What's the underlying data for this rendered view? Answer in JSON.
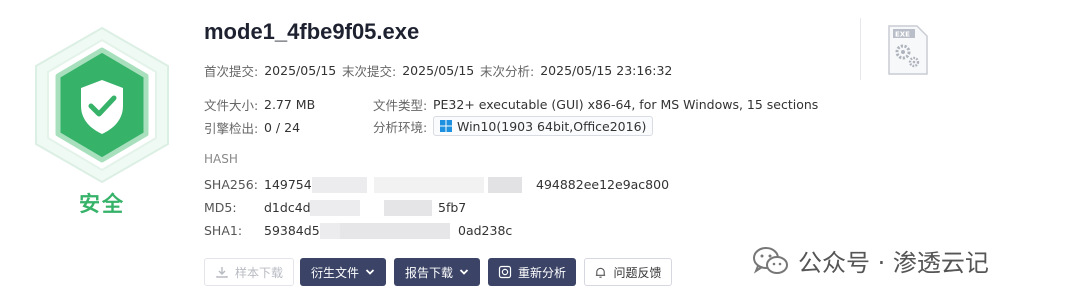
{
  "file": {
    "name": "mode1_4fbe9f05.exe"
  },
  "verdict": {
    "label": "安全",
    "color": "#36b269"
  },
  "dates": {
    "first_submit_label": "首次提交:",
    "first_submit": "2025/05/15",
    "last_submit_label": "末次提交:",
    "last_submit": "2025/05/15",
    "last_analysis_label": "末次分析:",
    "last_analysis": "2025/05/15 23:16:32"
  },
  "info": {
    "size_label": "文件大小:",
    "size": "2.77 MB",
    "type_label": "文件类型:",
    "type": "PE32+ executable (GUI) x86-64, for MS Windows, 15 sections",
    "engine_label": "引擎检出:",
    "engine": "0 / 24",
    "env_label": "分析环境:",
    "env": "Win10(1903 64bit,Office2016)"
  },
  "hash": {
    "heading": "HASH",
    "sha256_label": "SHA256:",
    "sha256_start": "149754d",
    "sha256_end": "494882ee12e9ac800",
    "md5_label": "MD5:",
    "md5_start": "d1dc4d3",
    "md5_end": "5fb7",
    "sha1_label": "SHA1:",
    "sha1_start": "59384d58",
    "sha1_end": "0ad238c"
  },
  "actions": {
    "sample_download": "样本下载",
    "derived_files": "衍生文件",
    "report_download": "报告下载",
    "reanalyze": "重新分析",
    "feedback": "问题反馈"
  },
  "file_icon_label": "EXE",
  "watermark": {
    "text": "公众号 · 渗透云记"
  }
}
